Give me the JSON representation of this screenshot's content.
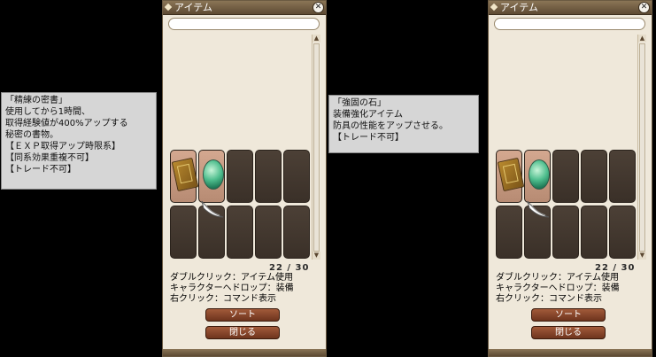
{
  "tooltip_left": {
    "lines": [
      "「精練の密書」",
      "使用してから1時間、",
      "取得経験値が400%アップする",
      "秘密の書物。",
      "【ＥＸＰ取得アップ時限系】",
      "【同系効果重複不可】",
      "【トレード不可】"
    ]
  },
  "tooltip_right": {
    "lines": [
      "「強固の石」",
      "装備強化アイテム",
      "防具の性能をアップさせる。",
      "【トレード不可】"
    ]
  },
  "window": {
    "title": "アイテム",
    "close_glyph": "✕",
    "count": "22 / 30",
    "help": [
      "ダブルクリック：アイテム使用",
      "キャラクターヘドロップ：装備",
      "右クリック：コマンド表示"
    ],
    "sort_label": "ソート",
    "close_label": "閉じる",
    "scroll_up_glyph": "▲",
    "scroll_down_glyph": "▼"
  },
  "items": [
    {
      "name": "精練の密書",
      "icon": "book-icon"
    },
    {
      "name": "強固の石",
      "icon": "green-stone-icon"
    }
  ],
  "colors": {
    "titlebar": "#6f5b3f",
    "panel": "#efe8da",
    "slot_empty": "#453a30",
    "button": "#8a4a2c",
    "tooltip_bg": "#d6d6d6"
  }
}
